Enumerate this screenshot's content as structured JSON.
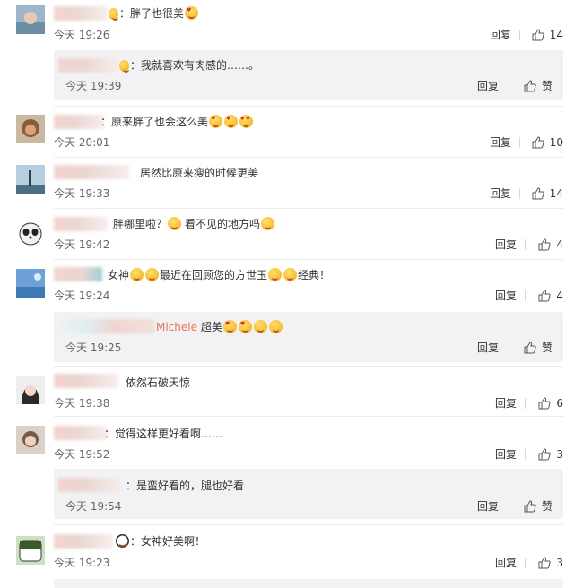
{
  "ui": {
    "reply": "回复",
    "like_zero": "赞"
  },
  "comments": [
    {
      "text": "：胖了也很美",
      "time": "今天 19:26",
      "likes": "14"
    },
    {
      "text": "：我就喜欢有肉感的……。",
      "time": "今天 19:39",
      "likes": "赞"
    },
    {
      "text": "：原来胖了也会这么美",
      "time": "今天 20:01",
      "likes": "10"
    },
    {
      "text": "居然比原来瘦的时候更美",
      "time": "今天 19:33",
      "likes": "14"
    },
    {
      "text_a": "胖哪里啦？",
      "text_b": "看不见的地方吗",
      "time": "今天 19:42",
      "likes": "4"
    },
    {
      "text_a": "女神",
      "text_b": "最近在回顾您的方世玉",
      "text_c": "经典！",
      "time": "今天 19:24",
      "likes": "4"
    },
    {
      "name": "Michele",
      "text": "超美",
      "time": "今天 19:25",
      "likes": "赞"
    },
    {
      "text": "依然石破天惊",
      "time": "今天 19:38",
      "likes": "6"
    },
    {
      "text": "：觉得这样更好看啊……",
      "time": "今天 19:52",
      "likes": "3"
    },
    {
      "text": "：是蛮好看的，腿也好看",
      "time": "今天 19:54",
      "likes": "赞"
    },
    {
      "text": "：女神好美啊！",
      "time": "今天 19:23",
      "likes": "3"
    }
  ],
  "icons": {
    "like": "thumbs-up-icon",
    "emoji": "emoji-icon"
  },
  "colors": {
    "background": "#ffffff",
    "sub_reply_bg": "#f2f2f5",
    "name_link": "#eb7350",
    "muted": "#666666"
  }
}
